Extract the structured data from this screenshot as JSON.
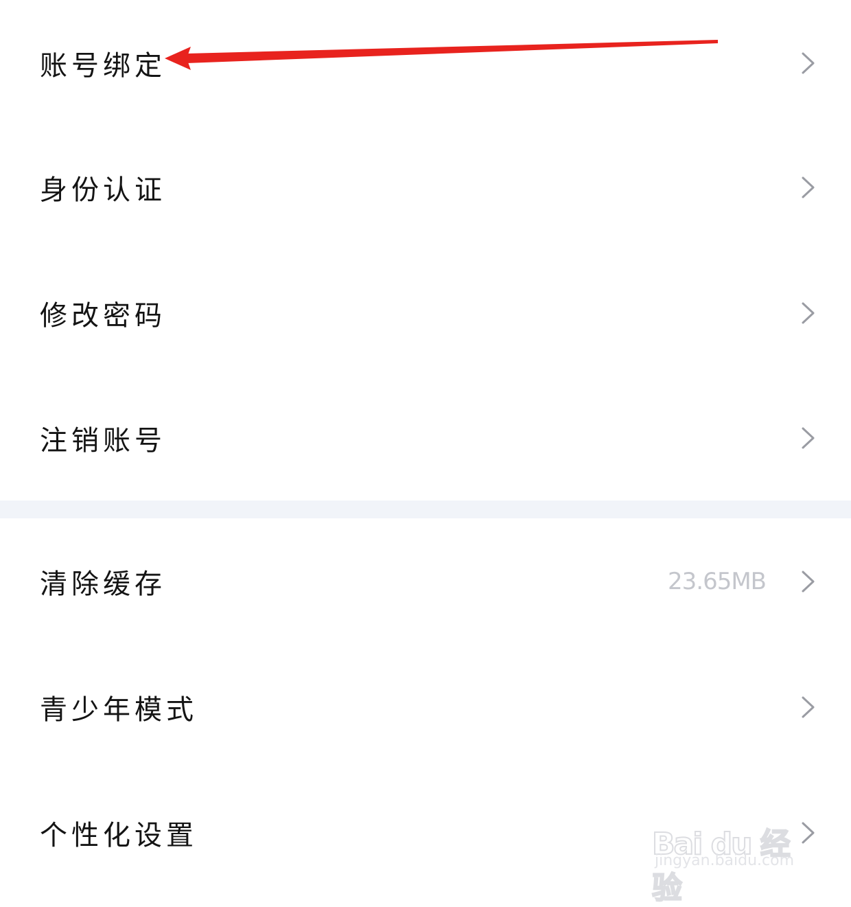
{
  "groups": [
    {
      "items": [
        {
          "label": "账号绑定"
        },
        {
          "label": "身份认证"
        },
        {
          "label": "修改密码"
        },
        {
          "label": "注销账号"
        }
      ]
    },
    {
      "items": [
        {
          "label": "清除缓存",
          "value": "23.65MB"
        },
        {
          "label": "青少年模式"
        },
        {
          "label": "个性化设置"
        }
      ]
    }
  ],
  "icons": {
    "row_chevron": "chevron-right-icon",
    "annotation": "red-arrow-icon"
  },
  "colors": {
    "background": "#ffffff",
    "divider": "#f1f4f9",
    "label": "#141414",
    "value": "#c4c6cc",
    "chevron": "#9a9ca3",
    "annotation": "#e8231e"
  },
  "watermark": {
    "logo": "Bai du 经验",
    "url": "jingyan.baidu.com"
  }
}
